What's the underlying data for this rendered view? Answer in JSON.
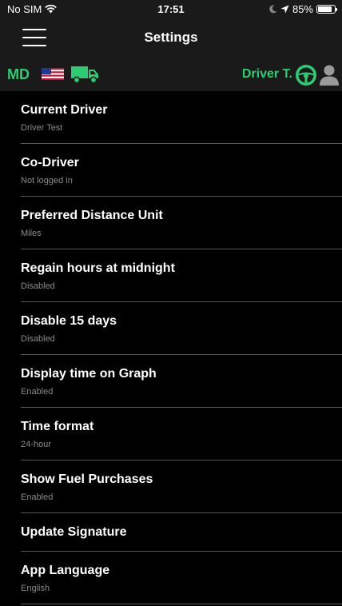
{
  "status_bar": {
    "carrier": "No SIM",
    "time": "17:51",
    "battery_percent": "85%",
    "battery_level": 0.85
  },
  "nav": {
    "title": "Settings"
  },
  "driver_bar": {
    "state_code": "MD",
    "driver_name": "Driver T.",
    "accent_color": "#2ecc71"
  },
  "settings": {
    "current_driver": {
      "title": "Current Driver",
      "value": "Driver Test"
    },
    "co_driver": {
      "title": "Co-Driver",
      "value": "Not logged in"
    },
    "distance_unit": {
      "title": "Preferred Distance Unit",
      "value": "Miles"
    },
    "regain_hours": {
      "title": "Regain hours at midnight",
      "value": "Disabled"
    },
    "disable_15_days": {
      "title": "Disable 15 days",
      "value": "Disabled"
    },
    "display_time": {
      "title": "Display time on Graph",
      "value": "Enabled"
    },
    "time_format": {
      "title": "Time format",
      "value": "24-hour"
    },
    "fuel_purchases": {
      "title": "Show Fuel Purchases",
      "value": "Enabled"
    },
    "update_signature": {
      "title": "Update Signature"
    },
    "app_language": {
      "title": "App Language",
      "value": "English"
    }
  }
}
